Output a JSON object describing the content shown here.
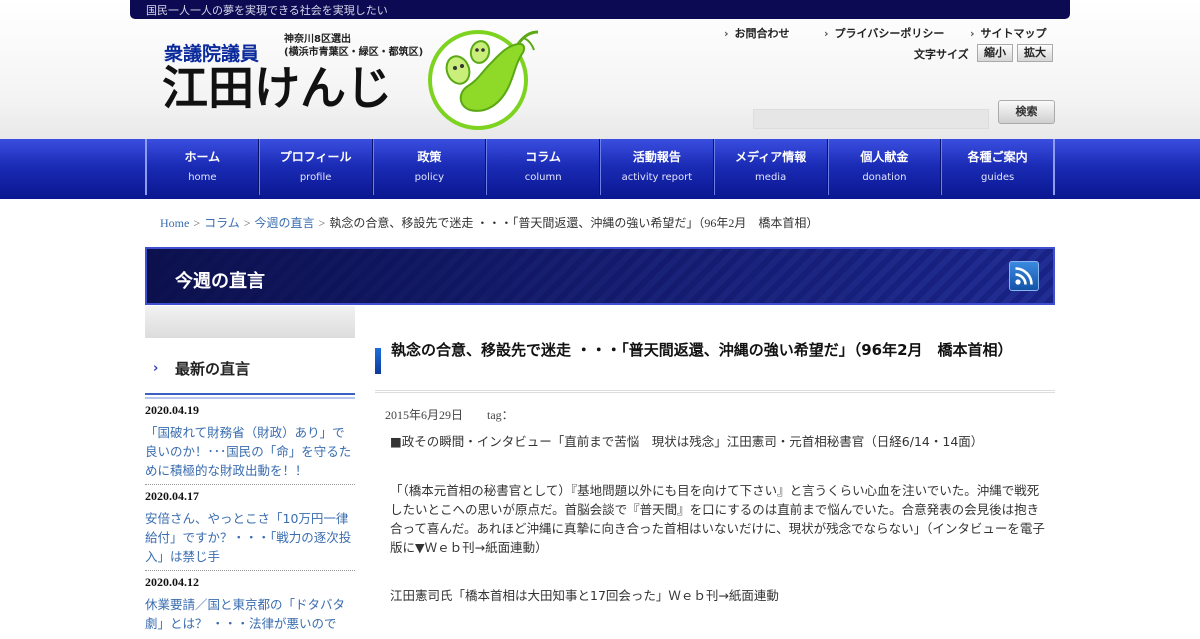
{
  "topbar": {
    "slogan": "国民一人一人の夢を実現できる社会を実現したい"
  },
  "logo": {
    "title": "衆議院議員",
    "district_line1": "神奈川8区選出",
    "district_line2": "(横浜市青葉区・緑区・都筑区)",
    "name": "江田けんじ"
  },
  "header_links": [
    "お問合わせ",
    "プライバシーポリシー",
    "サイトマップ"
  ],
  "font_size": {
    "label": "文字サイズ",
    "smaller": "縮小",
    "larger": "拡大"
  },
  "search": {
    "button": "検索",
    "placeholder": ""
  },
  "nav": [
    {
      "jp": "ホーム",
      "en": "home"
    },
    {
      "jp": "プロフィール",
      "en": "profile"
    },
    {
      "jp": "政策",
      "en": "policy"
    },
    {
      "jp": "コラム",
      "en": "column"
    },
    {
      "jp": "活動報告",
      "en": "activity report"
    },
    {
      "jp": "メディア情報",
      "en": "media"
    },
    {
      "jp": "個人献金",
      "en": "donation"
    },
    {
      "jp": "各種ご案内",
      "en": "guides"
    }
  ],
  "breadcrumb": {
    "home": "Home",
    "column": "コラム",
    "weekly": "今週の直言",
    "current": "執念の合意、移設先で迷走 ・・・「普天間返還、沖縄の強い希望だ」（96年2月　橋本首相）"
  },
  "section": {
    "title": "今週の直言"
  },
  "sidebar": {
    "heading": "最新の直言",
    "entries": [
      {
        "date": "2020.04.19",
        "title": "「国破れて財務省（財政）あり」で良いのか！･･･国民の「命」を守るために積極的な財政出動を！！"
      },
      {
        "date": "2020.04.17",
        "title": "安倍さん、やっとこさ「10万円一律給付」ですか？・・・「戦力の逐次投入」は禁じ手"
      },
      {
        "date": "2020.04.12",
        "title": "休業要請／国と東京都の「ドタバタ劇」とは？ ・・・法律が悪いので"
      }
    ]
  },
  "article": {
    "title": "執念の合意、移設先で迷走 ・・・「普天間返還、沖縄の強い希望だ」（96年2月　橋本首相）",
    "date": "2015年6月29日",
    "tag": "tag：",
    "p1": "■政その瞬間・インタビュー「直前まで苦悩　現状は残念」江田憲司・元首相秘書官（日経6/14・14面）",
    "p2": "「（橋本元首相の秘書官として）『基地問題以外にも目を向けて下さい』と言うくらい心血を注いでいた。沖縄で戦死したいとこへの思いが原点だ。首脳会談で『普天間』を口にするのは直前まで悩んでいた。合意発表の会見後は抱き合って喜んだ。あれほど沖縄に真摯に向き合った首相はいないだけに、現状が残念でならない」（インタビューを電子版に▼Ｗｅｂ刊→紙面連動）",
    "p3": "江田憲司氏「橋本首相は大田知事と17回会った」Ｗｅｂ刊→紙面連動"
  },
  "colors": {
    "navy": "#0c0a52",
    "nav_blue": "#1a2bb5",
    "link": "#3a6db0",
    "logo_blue": "#0b2a9c",
    "bean_green": "#7ed321"
  },
  "icons": {
    "rss": "rss-icon",
    "bean_logo": "edamame-logo-icon"
  }
}
